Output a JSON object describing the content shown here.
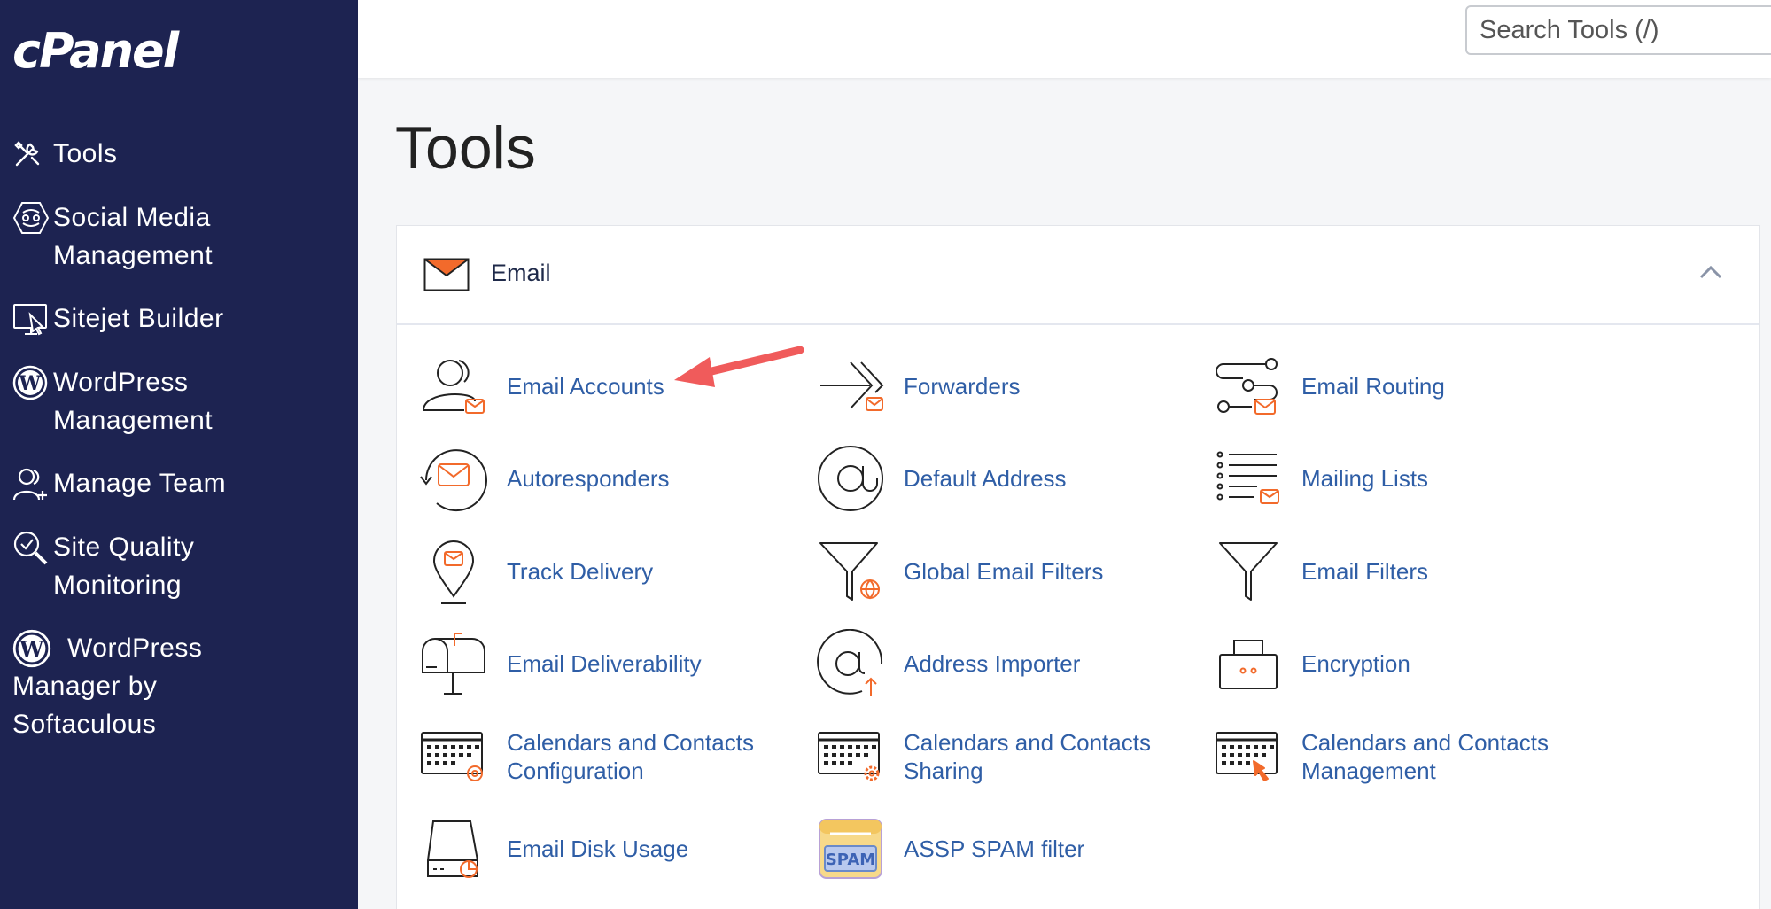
{
  "brand": {
    "logo_text": "cPanel"
  },
  "sidebar": {
    "items": [
      {
        "label": "Tools",
        "icon": "tools-icon"
      },
      {
        "label": "Social Media Management",
        "icon": "social-media-icon"
      },
      {
        "label": "Sitejet Builder",
        "icon": "sitejet-icon"
      },
      {
        "label": "WordPress Management",
        "icon": "wordpress-icon"
      },
      {
        "label": "Manage Team",
        "icon": "manage-team-icon"
      },
      {
        "label": "Site Quality Monitoring",
        "icon": "site-quality-icon"
      },
      {
        "label": "WordPress Manager by Softaculous",
        "icon": "wordpress-icon"
      }
    ]
  },
  "search": {
    "placeholder": "Search Tools (/)"
  },
  "page": {
    "title": "Tools"
  },
  "email_section": {
    "title": "Email",
    "accent_color": "#f26a2b",
    "link_color": "#2f5ea6",
    "tools": [
      {
        "label": "Email Accounts",
        "icon": "email-accounts-icon"
      },
      {
        "label": "Forwarders",
        "icon": "forwarders-icon"
      },
      {
        "label": "Email Routing",
        "icon": "email-routing-icon"
      },
      {
        "label": "Autoresponders",
        "icon": "autoresponders-icon"
      },
      {
        "label": "Default Address",
        "icon": "default-address-icon"
      },
      {
        "label": "Mailing Lists",
        "icon": "mailing-lists-icon"
      },
      {
        "label": "Track Delivery",
        "icon": "track-delivery-icon"
      },
      {
        "label": "Global Email Filters",
        "icon": "global-email-filters-icon"
      },
      {
        "label": "Email Filters",
        "icon": "email-filters-icon"
      },
      {
        "label": "Email Deliverability",
        "icon": "email-deliverability-icon"
      },
      {
        "label": "Address Importer",
        "icon": "address-importer-icon"
      },
      {
        "label": "Encryption",
        "icon": "encryption-icon"
      },
      {
        "label": "Calendars and Contacts Configuration",
        "icon": "calendar-config-icon"
      },
      {
        "label": "Calendars and Contacts Sharing",
        "icon": "calendar-sharing-icon"
      },
      {
        "label": "Calendars and Contacts Management",
        "icon": "calendar-management-icon"
      },
      {
        "label": "Email Disk Usage",
        "icon": "email-disk-usage-icon"
      },
      {
        "label": "ASSP SPAM filter",
        "icon": "spam-filter-icon"
      }
    ],
    "spam_badge": "SPAM"
  }
}
